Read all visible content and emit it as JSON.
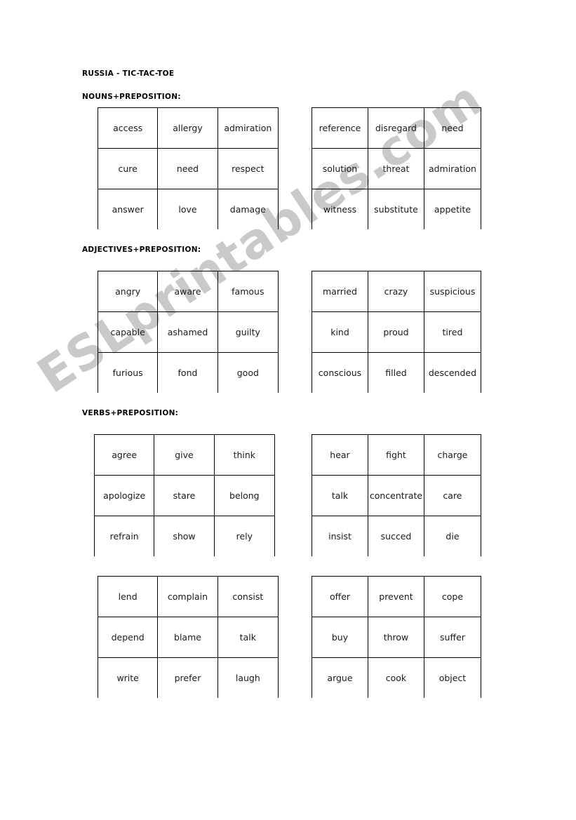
{
  "document": {
    "title": "RUSSIA - TIC-TAC-TOE",
    "watermark": "ESLprintables.com",
    "watermark_color": "#c9c9c9",
    "page_background": "#ffffff",
    "text_color": "#1a1a1a"
  },
  "sections": [
    {
      "heading": "NOUNS+PREPOSITION:",
      "grids": [
        {
          "name": "nouns-grid-1",
          "rows": [
            [
              "access",
              "allergy",
              "admiration"
            ],
            [
              "cure",
              "need",
              "respect"
            ],
            [
              "answer",
              "love",
              "damage"
            ]
          ]
        },
        {
          "name": "nouns-grid-2",
          "rows": [
            [
              "reference",
              "disregard",
              "need"
            ],
            [
              "solution",
              "threat",
              "admiration"
            ],
            [
              "witness",
              "substitute",
              "appetite"
            ]
          ]
        }
      ]
    },
    {
      "heading": "ADJECTIVES+PREPOSITION:",
      "grids": [
        {
          "name": "adjectives-grid-1",
          "rows": [
            [
              "angry",
              "aware",
              "famous"
            ],
            [
              "capable",
              "ashamed",
              "guilty"
            ],
            [
              "furious",
              "fond",
              "good"
            ]
          ]
        },
        {
          "name": "adjectives-grid-2",
          "rows": [
            [
              "married",
              "crazy",
              "suspicious"
            ],
            [
              "kind",
              "proud",
              "tired"
            ],
            [
              "conscious",
              "filled",
              "descended"
            ]
          ]
        }
      ]
    },
    {
      "heading": "VERBS+PREPOSITION:",
      "grids": [
        {
          "name": "verbs-grid-1",
          "rows": [
            [
              "agree",
              "give",
              "think"
            ],
            [
              "apologize",
              "stare",
              "belong"
            ],
            [
              "refrain",
              "show",
              "rely"
            ]
          ]
        },
        {
          "name": "verbs-grid-2",
          "rows": [
            [
              "hear",
              "fight",
              "charge"
            ],
            [
              "talk",
              "concentrate",
              "care"
            ],
            [
              "insist",
              "succed",
              "die"
            ]
          ]
        },
        {
          "name": "verbs-grid-3",
          "rows": [
            [
              "lend",
              "complain",
              "consist"
            ],
            [
              "depend",
              "blame",
              "talk"
            ],
            [
              "write",
              "prefer",
              "laugh"
            ]
          ]
        },
        {
          "name": "verbs-grid-4",
          "rows": [
            [
              "offer",
              "prevent",
              "cope"
            ],
            [
              "buy",
              "throw",
              "suffer"
            ],
            [
              "argue",
              "cook",
              "object"
            ]
          ]
        }
      ]
    }
  ]
}
